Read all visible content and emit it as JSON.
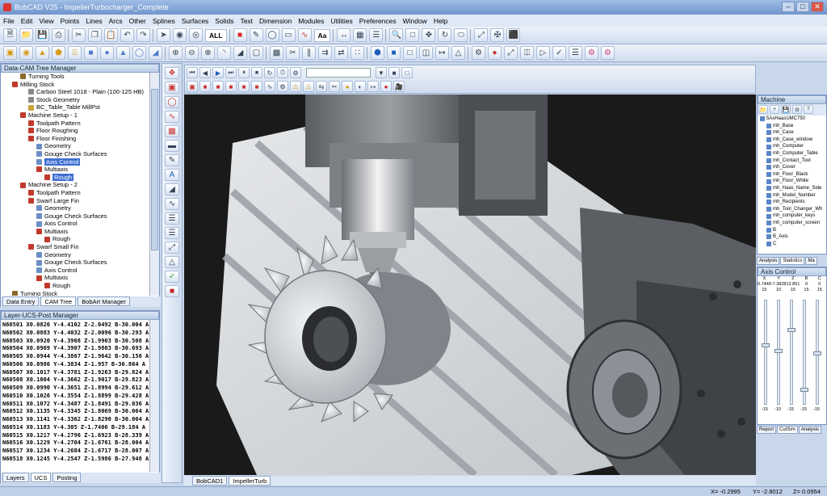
{
  "window": {
    "title": "BobCAD V25 - ImpellerTurbocharger_Complete"
  },
  "menu": [
    "File",
    "Edit",
    "View",
    "Points",
    "Lines",
    "Arcs",
    "Other",
    "Splines",
    "Surfaces",
    "Solids",
    "Text",
    "Dimension",
    "Modules",
    "Utilities",
    "Preferences",
    "Window",
    "Help"
  ],
  "toolbar": {
    "all_label": "ALL",
    "text_label": "Aa"
  },
  "cam_tree": {
    "title": "Data-CAM Tree Manager",
    "nodes": [
      {
        "label": "Turning Tools",
        "indent": 2,
        "color": "#8a6a2a"
      },
      {
        "label": "Milling Stock",
        "indent": 1,
        "color": "#c0392b"
      },
      {
        "label": "Carbon Steel 1018 - Plain (100-125 HB)",
        "indent": 3,
        "color": "#888"
      },
      {
        "label": "Stock Geometry",
        "indent": 3,
        "color": "#888"
      },
      {
        "label": "BC_Table_Table MillPst",
        "indent": 3,
        "color": "#c9a43a"
      },
      {
        "label": "Machine Setup - 1",
        "indent": 2,
        "color": "#c0392b"
      },
      {
        "label": "Toolpath Pattern",
        "indent": 3,
        "color": "#c0392b"
      },
      {
        "label": "Floor Roughing",
        "indent": 3,
        "color": "#c0392b"
      },
      {
        "label": "Floor Finishing",
        "indent": 3,
        "color": "#c0392b"
      },
      {
        "label": "Geometry",
        "indent": 4,
        "color": "#6b8fc4"
      },
      {
        "label": "Gouge Check Surfaces",
        "indent": 4,
        "color": "#6b8fc4"
      },
      {
        "label": "Axis Control",
        "indent": 4,
        "color": "#6b8fc4",
        "selected": true
      },
      {
        "label": "Multiaxis",
        "indent": 4,
        "color": "#c0392b"
      },
      {
        "label": "Rough",
        "indent": 5,
        "color": "#c0392b",
        "selected": true
      },
      {
        "label": "Machine Setup - 2",
        "indent": 2,
        "color": "#c0392b"
      },
      {
        "label": "Toolpath Pattern",
        "indent": 3,
        "color": "#c0392b"
      },
      {
        "label": "Swarf Large Fin",
        "indent": 3,
        "color": "#c0392b"
      },
      {
        "label": "Geometry",
        "indent": 4,
        "color": "#6b8fc4"
      },
      {
        "label": "Gouge Check Surfaces",
        "indent": 4,
        "color": "#6b8fc4"
      },
      {
        "label": "Axis Control",
        "indent": 4,
        "color": "#6b8fc4"
      },
      {
        "label": "Multiaxis",
        "indent": 4,
        "color": "#c0392b"
      },
      {
        "label": "Rough",
        "indent": 5,
        "color": "#c0392b"
      },
      {
        "label": "Swarf Small Fin",
        "indent": 3,
        "color": "#c0392b"
      },
      {
        "label": "Geometry",
        "indent": 4,
        "color": "#6b8fc4"
      },
      {
        "label": "Gouge Check Surfaces",
        "indent": 4,
        "color": "#6b8fc4"
      },
      {
        "label": "Axis Control",
        "indent": 4,
        "color": "#6b8fc4"
      },
      {
        "label": "Multiaxis",
        "indent": 4,
        "color": "#c0392b"
      },
      {
        "label": "Rough",
        "indent": 5,
        "color": "#c0392b"
      },
      {
        "label": "Turning Stock",
        "indent": 1,
        "color": "#8a6a2a"
      }
    ],
    "tabs": [
      "Data Entry",
      "CAM Tree",
      "BobArt Manager"
    ]
  },
  "nc_panel": {
    "title": "Layer-UCS-Post Manager",
    "lines": [
      "N60501 X0.0826 Y-4.4102 Z-2.0492 B-30.004 A",
      "N60502 X0.0883 Y-4.4032 Z-2.0096 B-30.293 A",
      "N60503 X0.0920 Y-4.3968 Z-1.9903 B-30.508 A",
      "N60504 X0.0969 Y-4.3907 Z-1.9803 B-30.693 A",
      "N60505 X0.0944 Y-4.3867 Z-1.9642 B-30.156 A",
      "N60506 X0.0986 Y-4.3834 Z-1.957 B-30.864 A",
      "N60507 X0.1017 Y-4.3781 Z-1.9263 B-29.824 A",
      "N60508 X0.1004 Y-4.3662 Z-1.9017 B-29.823 A",
      "N60509 X0.0990 Y-4.3651 Z-1.8994 B-29.612 A",
      "N60510 X0.1026 Y-4.3554 Z-1.8899 B-29.428 A",
      "N60511 X0.1072 Y-4.3487 Z-1.8491 B-29.036 A",
      "N60512 X0.1135 Y-4.3345 Z-1.8069 B-30.004 A",
      "N60513 X0.1141 Y-4.3362 Z-1.8290 B-30.004 A",
      "N60514 X0.1183 Y-4.305 Z-1.7406 B-29.184 A",
      "N60515 X0.1217 Y-4.2796 Z-1.6923 B-28.339 A",
      "N60516 X0.1229 Y-4.2704 Z-1.6761 B-28.004 A",
      "N60517 X0.1234 Y-4.2684 Z-1.6717 B-28.007 A",
      "N60518 X0.1245 Y-4.2547 Z-1.5986 B-27.948 A"
    ],
    "tabs": [
      "Layers",
      "UCS",
      "Posting"
    ]
  },
  "viewport": {
    "tabs": [
      "BobCAD1",
      "ImpellerTurb"
    ]
  },
  "machine_panel": {
    "title": "Machine",
    "root": "5AxHaasUMC750",
    "items": [
      "mh_Base",
      "mh_Case",
      "mh_Case_window",
      "mh_Computer",
      "mh_Computer_Table",
      "mh_Contact_Tool",
      "mh_Cover",
      "mh_Floor_Black",
      "mh_Floor_White",
      "mh_Haas_Name_Side",
      "mh_Model_Number",
      "mh_Recipients",
      "mh_Tool_Changer_Wh",
      "mh_computer_keys",
      "mh_computer_screen",
      "B",
      "B_Axis",
      "C"
    ],
    "tabs": [
      "Analysis",
      "Statistics",
      "Ma"
    ]
  },
  "axis_control": {
    "title": "Axis Control",
    "headers": [
      "X",
      "Y",
      "Z",
      "B",
      "C"
    ],
    "values": [
      "0.7449",
      "-7.3828",
      "12.851",
      "0",
      "0"
    ],
    "limits_top": [
      "15",
      "10",
      "15",
      "15",
      "15"
    ],
    "limits_bottom": [
      "-15",
      "-10",
      "-15",
      "-15",
      "-15"
    ],
    "levels": [
      0.42,
      0.48,
      0.27,
      0.86,
      0.5
    ],
    "tabs": [
      "Report",
      "CutSim",
      "Analysis"
    ]
  },
  "status": {
    "x": "X= -0.2995",
    "y": "Y= -2.8012",
    "z": "Z= 0.0954"
  }
}
